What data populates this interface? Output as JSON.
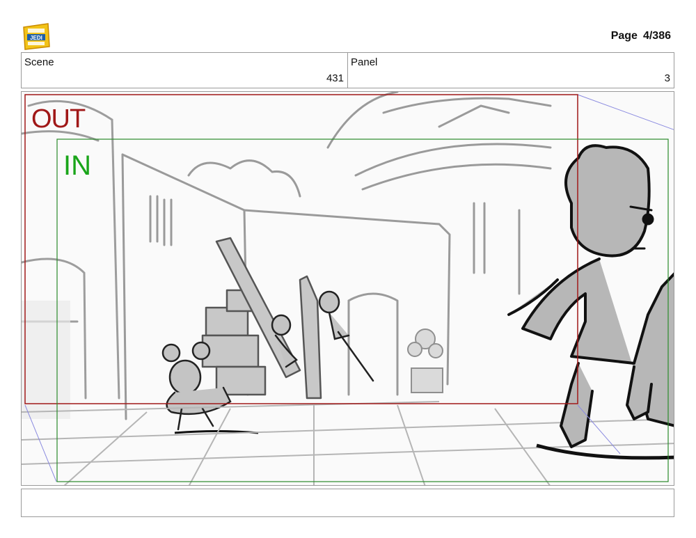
{
  "header": {
    "logo_text": "YOUNG JEDI ADVENTURES",
    "page_label": "Page",
    "page_number": "4/386"
  },
  "info": {
    "scene_label": "Scene",
    "scene_value": "431",
    "panel_label": "Panel",
    "panel_value": "3"
  },
  "panel": {
    "out_label": "OUT",
    "in_label": "IN",
    "out_color": "#a01818",
    "in_color": "#1aa51a"
  },
  "notes": {
    "text": ""
  }
}
